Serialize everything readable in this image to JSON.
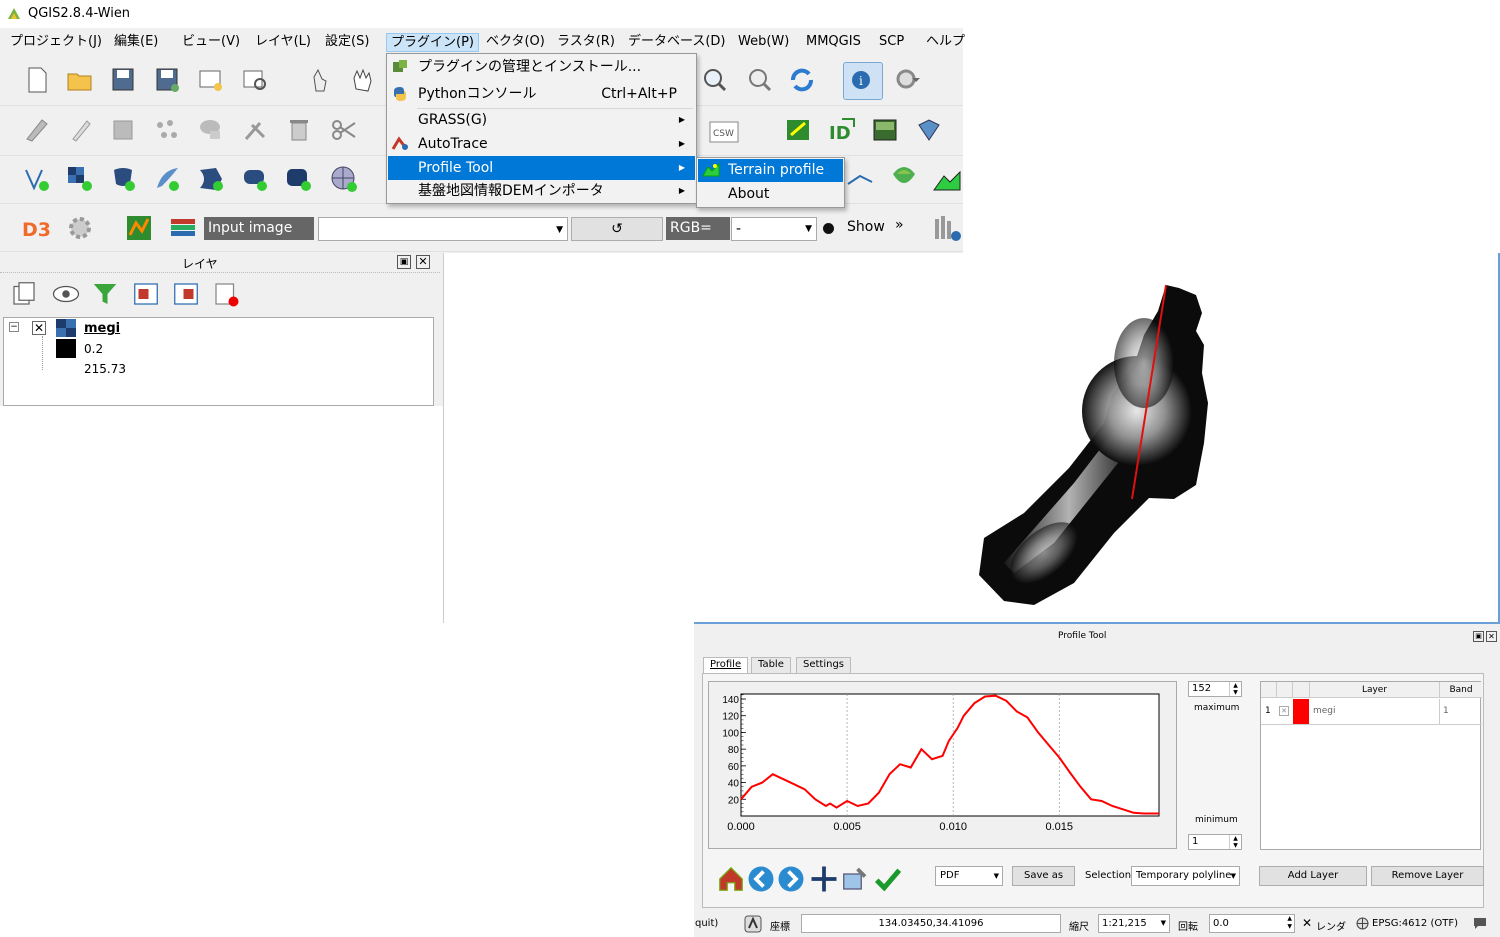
{
  "window": {
    "title": "QGIS2.8.4-Wien"
  },
  "menubar": {
    "items": [
      {
        "label": "プロジェクト(J)"
      },
      {
        "label": "編集(E)"
      },
      {
        "label": "ビュー(V)"
      },
      {
        "label": "レイヤ(L)"
      },
      {
        "label": "設定(S)"
      },
      {
        "label": "プラグイン(P)"
      },
      {
        "label": "ベクタ(O)"
      },
      {
        "label": "ラスタ(R)"
      },
      {
        "label": "データベース(D)"
      },
      {
        "label": "Web(W)"
      },
      {
        "label": "MMQGIS"
      },
      {
        "label": "SCP"
      },
      {
        "label": "ヘルプ"
      }
    ]
  },
  "plugin_menu": {
    "items": [
      {
        "label": "プラグインの管理とインストール...",
        "icon": "plugin-manager-icon"
      },
      {
        "label": "Pythonコンソール",
        "shortcut": "Ctrl+Alt+P",
        "icon": "python-icon"
      },
      {
        "label": "GRASS(G)"
      },
      {
        "label": "AutoTrace",
        "icon": "autotrace-icon"
      },
      {
        "label": "Profile Tool"
      },
      {
        "label": "基盤地図情報DEMインポータ"
      }
    ]
  },
  "submenu": {
    "items": [
      {
        "label": "Terrain profile",
        "icon": "terrain-profile-icon"
      },
      {
        "label": "About"
      }
    ]
  },
  "scp_toolbar": {
    "input_image_label": "Input image",
    "rgb_label": "RGB=",
    "rgb_value": "-",
    "show_label": "Show",
    "refresh_glyph": "↺",
    "more_glyph": "»"
  },
  "layers_panel": {
    "title": "レイヤ",
    "layer_name": "megi",
    "legend": [
      {
        "value": "0.2",
        "color": "#000000"
      },
      {
        "value": "215.73",
        "color": "#ffffff"
      }
    ]
  },
  "profile_tool": {
    "title": "Profile Tool",
    "tabs": [
      "Profile",
      "Table",
      "Settings"
    ],
    "max_value": "152",
    "max_label": "maximum",
    "min_value": "1",
    "min_label": "minimum",
    "layer_table": {
      "headers": [
        "Layer",
        "Band"
      ],
      "rows": [
        {
          "index": "1",
          "color": "#ff0000",
          "layer": "megi",
          "band": "1"
        }
      ]
    },
    "export_format": "PDF",
    "save_as_label": "Save as",
    "selection_label": "Selection",
    "selection_value": "Temporary polyline",
    "add_layer_label": "Add Layer",
    "remove_layer_label": "Remove Layer"
  },
  "chart_data": {
    "type": "line",
    "title": "",
    "xlabel": "",
    "ylabel": "",
    "xlim": [
      0.0,
      0.0197
    ],
    "ylim": [
      0,
      146
    ],
    "x_ticks": [
      "0.000",
      "0.005",
      "0.010",
      "0.015"
    ],
    "y_ticks": [
      "20",
      "40",
      "60",
      "80",
      "100",
      "120",
      "140"
    ],
    "grid": true,
    "series": [
      {
        "color": "#ff0000",
        "x": [
          0.0,
          0.0005,
          0.001,
          0.0015,
          0.002,
          0.0025,
          0.003,
          0.0035,
          0.004,
          0.0042,
          0.0045,
          0.005,
          0.0055,
          0.006,
          0.0065,
          0.007,
          0.0075,
          0.008,
          0.0085,
          0.009,
          0.0095,
          0.0098,
          0.0102,
          0.0105,
          0.011,
          0.0115,
          0.012,
          0.0125,
          0.013,
          0.0135,
          0.014,
          0.0145,
          0.015,
          0.0155,
          0.016,
          0.0165,
          0.017,
          0.0175,
          0.018,
          0.0185,
          0.019,
          0.0197
        ],
        "y": [
          20,
          35,
          40,
          50,
          44,
          38,
          32,
          20,
          12,
          15,
          10,
          18,
          12,
          15,
          28,
          50,
          62,
          58,
          80,
          68,
          72,
          90,
          105,
          120,
          135,
          143,
          144,
          138,
          125,
          118,
          100,
          85,
          70,
          52,
          35,
          20,
          18,
          12,
          8,
          4,
          3,
          3
        ]
      }
    ]
  },
  "statusbar": {
    "left_text": "quit)",
    "coord_label": "座標",
    "coord_value": "134.03450,34.41096",
    "scale_label": "縮尺",
    "scale_value": "1:21,215",
    "rotation_label": "回転",
    "rotation_value": "0.0",
    "render_label": "レンダ",
    "crs_label": "EPSG:4612 (OTF)"
  }
}
